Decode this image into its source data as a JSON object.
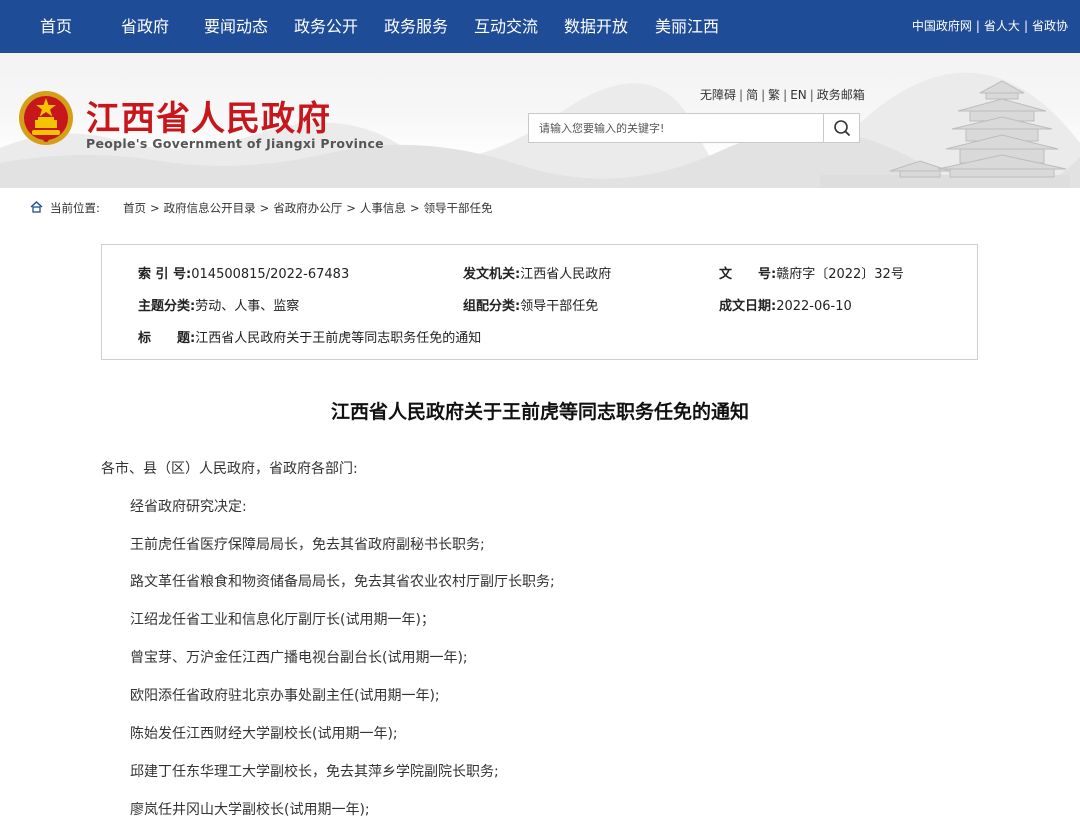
{
  "nav": {
    "items": [
      "首页",
      "省政府",
      "要闻动态",
      "政务公开",
      "政务服务",
      "互动交流",
      "数据开放",
      "美丽江西"
    ],
    "links": [
      "中国政府网",
      "省人大",
      "省政协"
    ]
  },
  "header": {
    "title": "江西省人民政府",
    "subtitle": "People's Government of Jiangxi Province",
    "util_links": [
      "无障碍",
      "简",
      "繁",
      "EN",
      "政务邮箱"
    ],
    "search_placeholder": "请输入您要输入的关键字!"
  },
  "breadcrumb": {
    "label": "当前位置:",
    "items": [
      "首页",
      "政府信息公开目录",
      "省政府办公厅",
      "人事信息",
      "领导干部任免"
    ]
  },
  "meta": {
    "index_label": "索 引 号:",
    "index_value": "014500815/2022-67483",
    "issuer_label": "发文机关:",
    "issuer_value": "江西省人民政府",
    "docno_label": "文　　号:",
    "docno_value": "赣府字〔2022〕32号",
    "topic_label": "主题分类:",
    "topic_value": "劳动、人事、监察",
    "category_label": "组配分类:",
    "category_value": "领导干部任免",
    "date_label": "成文日期:",
    "date_value": "2022-06-10",
    "title_label": "标　　题:",
    "title_value": "江西省人民政府关于王前虎等同志职务任免的通知"
  },
  "article": {
    "title": "江西省人民政府关于王前虎等同志职务任免的通知",
    "greeting": "各市、县（区）人民政府，省政府各部门:",
    "paragraphs": [
      "经省政府研究决定:",
      "王前虎任省医疗保障局局长，免去其省政府副秘书长职务;",
      "路文革任省粮食和物资储备局局长，免去其省农业农村厅副厅长职务;",
      "江绍龙任省工业和信息化厅副厅长(试用期一年)；",
      "曾宝芽、万沪金任江西广播电视台副台长(试用期一年);",
      "欧阳添任省政府驻北京办事处副主任(试用期一年);",
      "陈始发任江西财经大学副校长(试用期一年);",
      "邱建丁任东华理工大学副校长，免去其萍乡学院副院长职务;",
      "廖岚任井冈山大学副校长(试用期一年);"
    ]
  },
  "icons": {
    "emblem": "national-emblem-icon",
    "search": "search-icon",
    "home": "home-icon",
    "tower": "tengwang-pavilion-illustration"
  },
  "colors": {
    "nav_bg": "#1f4c97",
    "title_red": "#c8161d"
  }
}
